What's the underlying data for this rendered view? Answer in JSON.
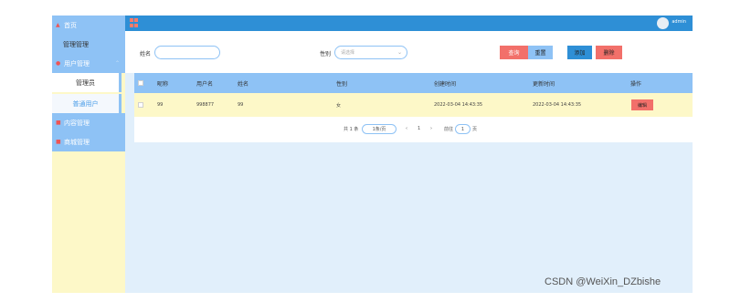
{
  "sidebar": {
    "home": "首页",
    "overlay_text": "管理管理",
    "user_mgmt": "用户管理",
    "sub_admin": "管理员",
    "sub_normal": "普通用户",
    "content_mgmt": "内容管理",
    "mall_mgmt": "商城管理"
  },
  "header": {
    "user": "admin"
  },
  "search": {
    "name_label": "姓名",
    "gender_label": "性别",
    "gender_placeholder": "请选择",
    "query": "查询",
    "reset": "重置",
    "add": "添加",
    "delete": "删除"
  },
  "table": {
    "headers": [
      "昵称",
      "用户名",
      "姓名",
      "性别",
      "创建时间",
      "更新时间",
      "操作"
    ],
    "rows": [
      {
        "nickname": "99",
        "username": "998877",
        "name": "99",
        "gender": "女",
        "created": "2022-03-04 14:43:35",
        "updated": "2022-03-04 14:43:35",
        "action": "编辑"
      }
    ]
  },
  "pagination": {
    "total": "共 1 条",
    "page_size": "1条/页",
    "prev": "‹",
    "page": "1",
    "next": "›",
    "goto_label": "前往",
    "goto_value": "1",
    "goto_suffix": "页"
  },
  "watermark": "CSDN @WeiXin_DZbishe",
  "colors": {
    "topbar": "#2e8fd6",
    "nav": "#8ec2f5",
    "sidebar_bg": "#fdf8c8",
    "main_bg": "#e1effb",
    "danger": "#f2706a"
  }
}
